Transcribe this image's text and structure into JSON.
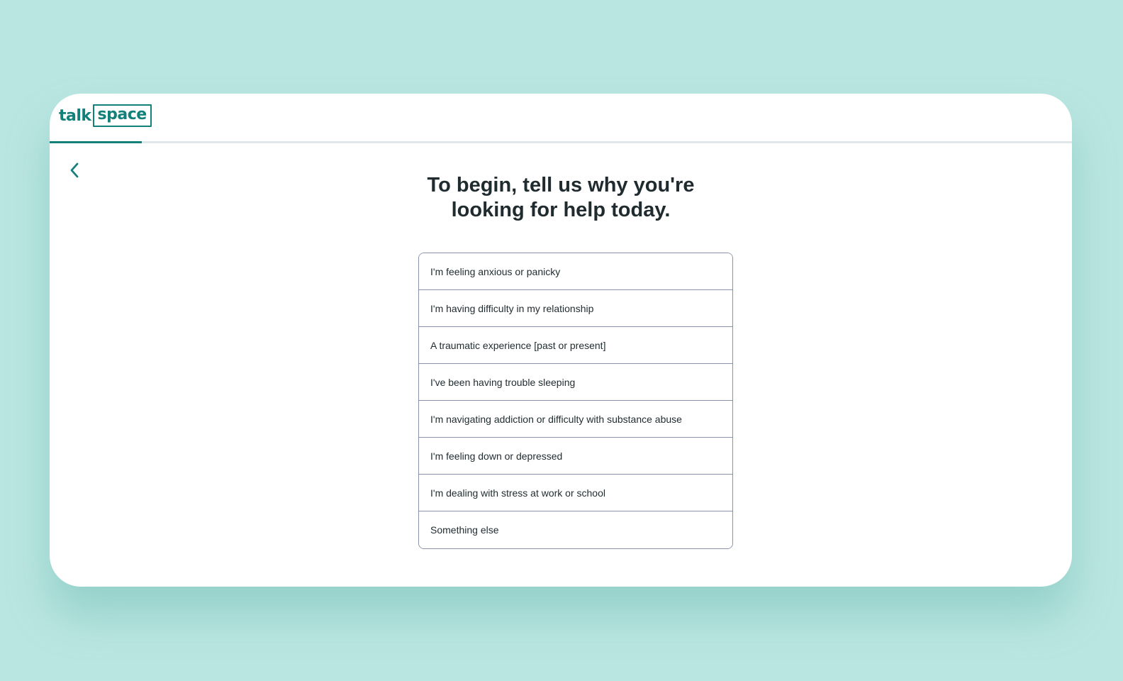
{
  "brand": {
    "logo_part1": "talk",
    "logo_part2": "space",
    "color": "#13807a"
  },
  "progress": {
    "percent": 9
  },
  "nav": {
    "back_icon": "chevron-left-icon"
  },
  "question": {
    "title_line1": "To begin, tell us why you're",
    "title_line2": "looking for help today."
  },
  "options": [
    {
      "label": "I'm feeling anxious or panicky"
    },
    {
      "label": "I'm having difficulty in my relationship"
    },
    {
      "label": "A traumatic experience [past or present]"
    },
    {
      "label": "I've been having trouble sleeping"
    },
    {
      "label": "I'm navigating addiction or difficulty with substance abuse"
    },
    {
      "label": "I'm feeling down or depressed"
    },
    {
      "label": "I'm dealing with stress at work or school"
    },
    {
      "label": "Something else"
    }
  ]
}
